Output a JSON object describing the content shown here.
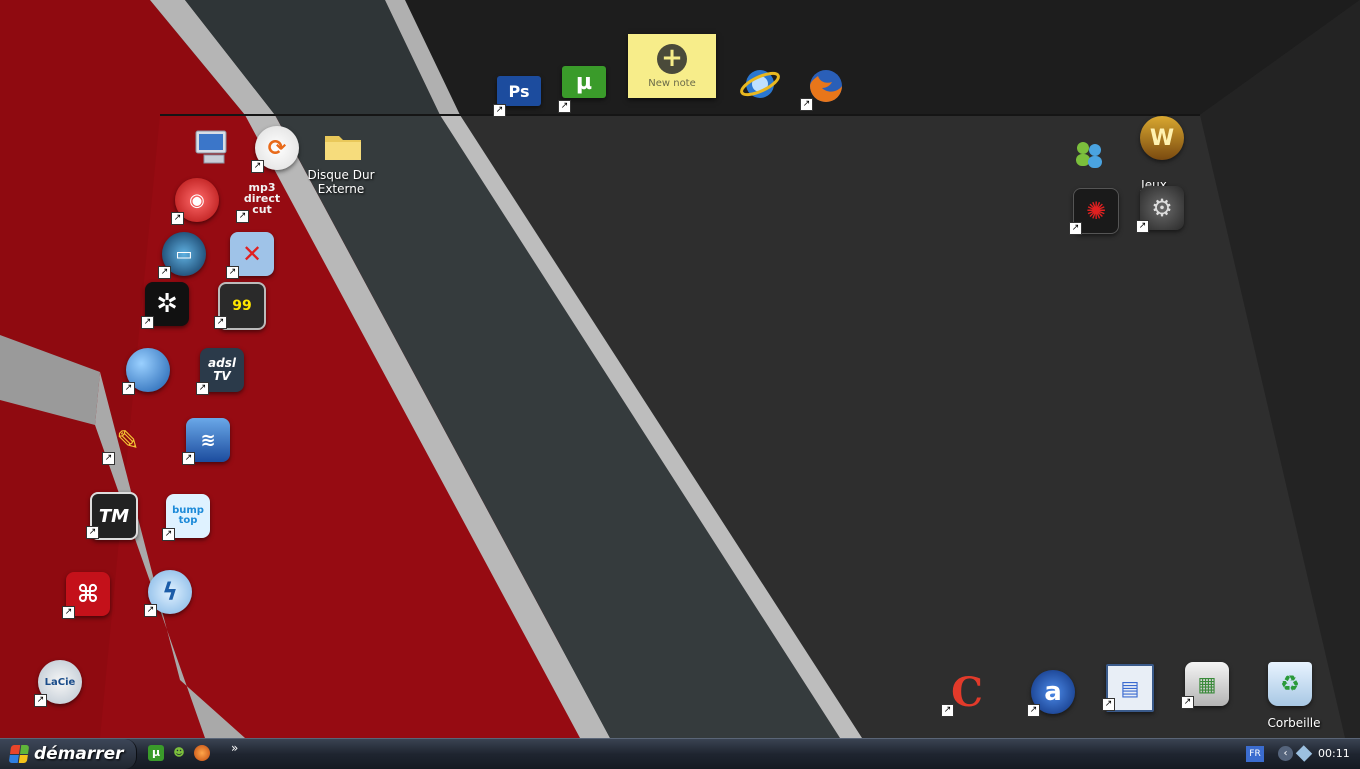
{
  "desktop": {
    "icons": {
      "drive": {
        "label": "Disque Dur Externe"
      },
      "games": {
        "label": "Jeux"
      },
      "recycle": {
        "label": "Corbeille"
      }
    },
    "note": {
      "label": "New note"
    },
    "glyphs": {
      "photoshop": "Ps",
      "utorrent": "µ",
      "mp3cut": "mp3 direct cut",
      "fraps": "99",
      "adsltv": "adsl TV",
      "tm": "TM",
      "bumptop": "bump top",
      "avast": "a",
      "lacie": "LaCie",
      "wow": "W"
    }
  },
  "taskbar": {
    "start_label": "démarrer",
    "lang": "FR",
    "clock": "00:11",
    "quicklaunch_more": "»"
  },
  "colors": {
    "red_wall": "#8f0a10",
    "dark_floor": "#2c2c2c",
    "stripe_gray": "#bdbdbd",
    "slate_stripe": "#353b3d",
    "taskbar": "#1f2530",
    "note_yellow": "#f7ed8a"
  }
}
